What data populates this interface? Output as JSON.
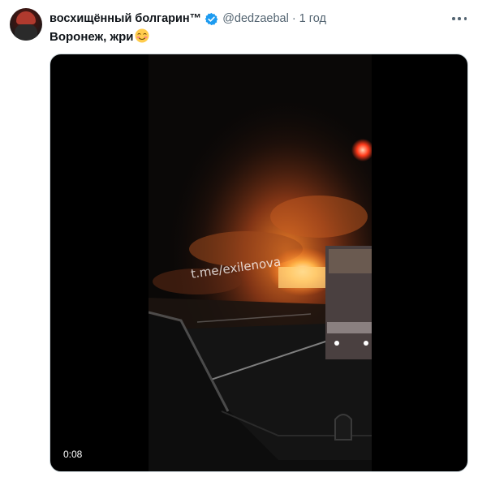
{
  "tweet": {
    "display_name": "восхищённый болгарин™",
    "handle": "@dedzaebal",
    "time": "1 год",
    "text": "Воронеж, жри",
    "emoji": "smiling-face-emoji"
  },
  "icons": {
    "verified": "verified-badge-icon",
    "more": "more-options-icon"
  },
  "media": {
    "watermark": "t.me/exilenova",
    "duration": "0:08"
  },
  "colors": {
    "verified": "#1d9bf0",
    "text_primary": "#0f1419",
    "text_secondary": "#536471",
    "media_border": "#cfd9de"
  }
}
